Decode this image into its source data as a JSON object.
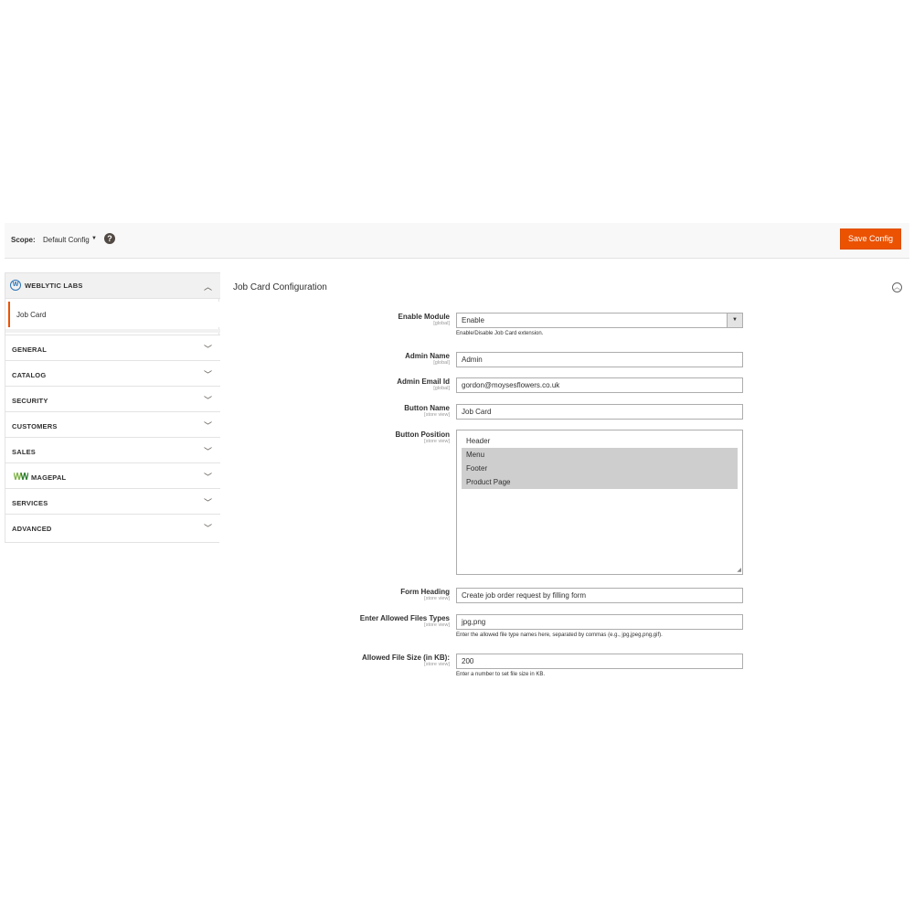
{
  "scope_bar": {
    "label": "Scope:",
    "current_scope": "Default Config",
    "help_symbol": "?",
    "save_label": "Save Config",
    "accent_color": "#eb5202"
  },
  "sidebar": {
    "tab": {
      "title": "WEBLYTIC LABS",
      "logo_letter": "W",
      "items": [
        {
          "label": "Job Card",
          "active": true
        }
      ]
    },
    "sections": [
      {
        "title": "GENERAL"
      },
      {
        "title": "CATALOG"
      },
      {
        "title": "SECURITY"
      },
      {
        "title": "CUSTOMERS"
      },
      {
        "title": "SALES"
      },
      {
        "title": "MAGEPAL",
        "has_logo": true
      },
      {
        "title": "SERVICES"
      },
      {
        "title": "ADVANCED"
      }
    ]
  },
  "main": {
    "section_title": "Job Card Configuration",
    "fields": {
      "enable_module": {
        "label": "Enable Module",
        "scope": "[global]",
        "value": "Enable",
        "note": "Enable/Disable Job Card extension."
      },
      "admin_name": {
        "label": "Admin Name",
        "scope": "[global]",
        "value": "Admin"
      },
      "admin_email": {
        "label": "Admin Email Id",
        "scope": "[global]",
        "value": "gordon@moysesflowers.co.uk"
      },
      "button_name": {
        "label": "Button Name",
        "scope": "[store view]",
        "value": "Job Card"
      },
      "button_position": {
        "label": "Button Position",
        "scope": "[store view]",
        "options": [
          {
            "label": "Header",
            "selected": false
          },
          {
            "label": "Menu",
            "selected": true
          },
          {
            "label": "Footer",
            "selected": true
          },
          {
            "label": "Product Page",
            "selected": true
          }
        ]
      },
      "form_heading": {
        "label": "Form Heading",
        "scope": "[store view]",
        "value": "Create job order request by filling form"
      },
      "allowed_types": {
        "label": "Enter Allowed Files Types",
        "scope": "[store view]",
        "value": "jpg,png",
        "note": "Enter the allowed file type names here, separated by commas (e.g., jpg,jpeg,png,gif)."
      },
      "file_size": {
        "label": "Allowed File Size (in KB):",
        "scope": "[store view]",
        "value": "200",
        "note": "Enter a number to set file size in KB."
      }
    }
  }
}
